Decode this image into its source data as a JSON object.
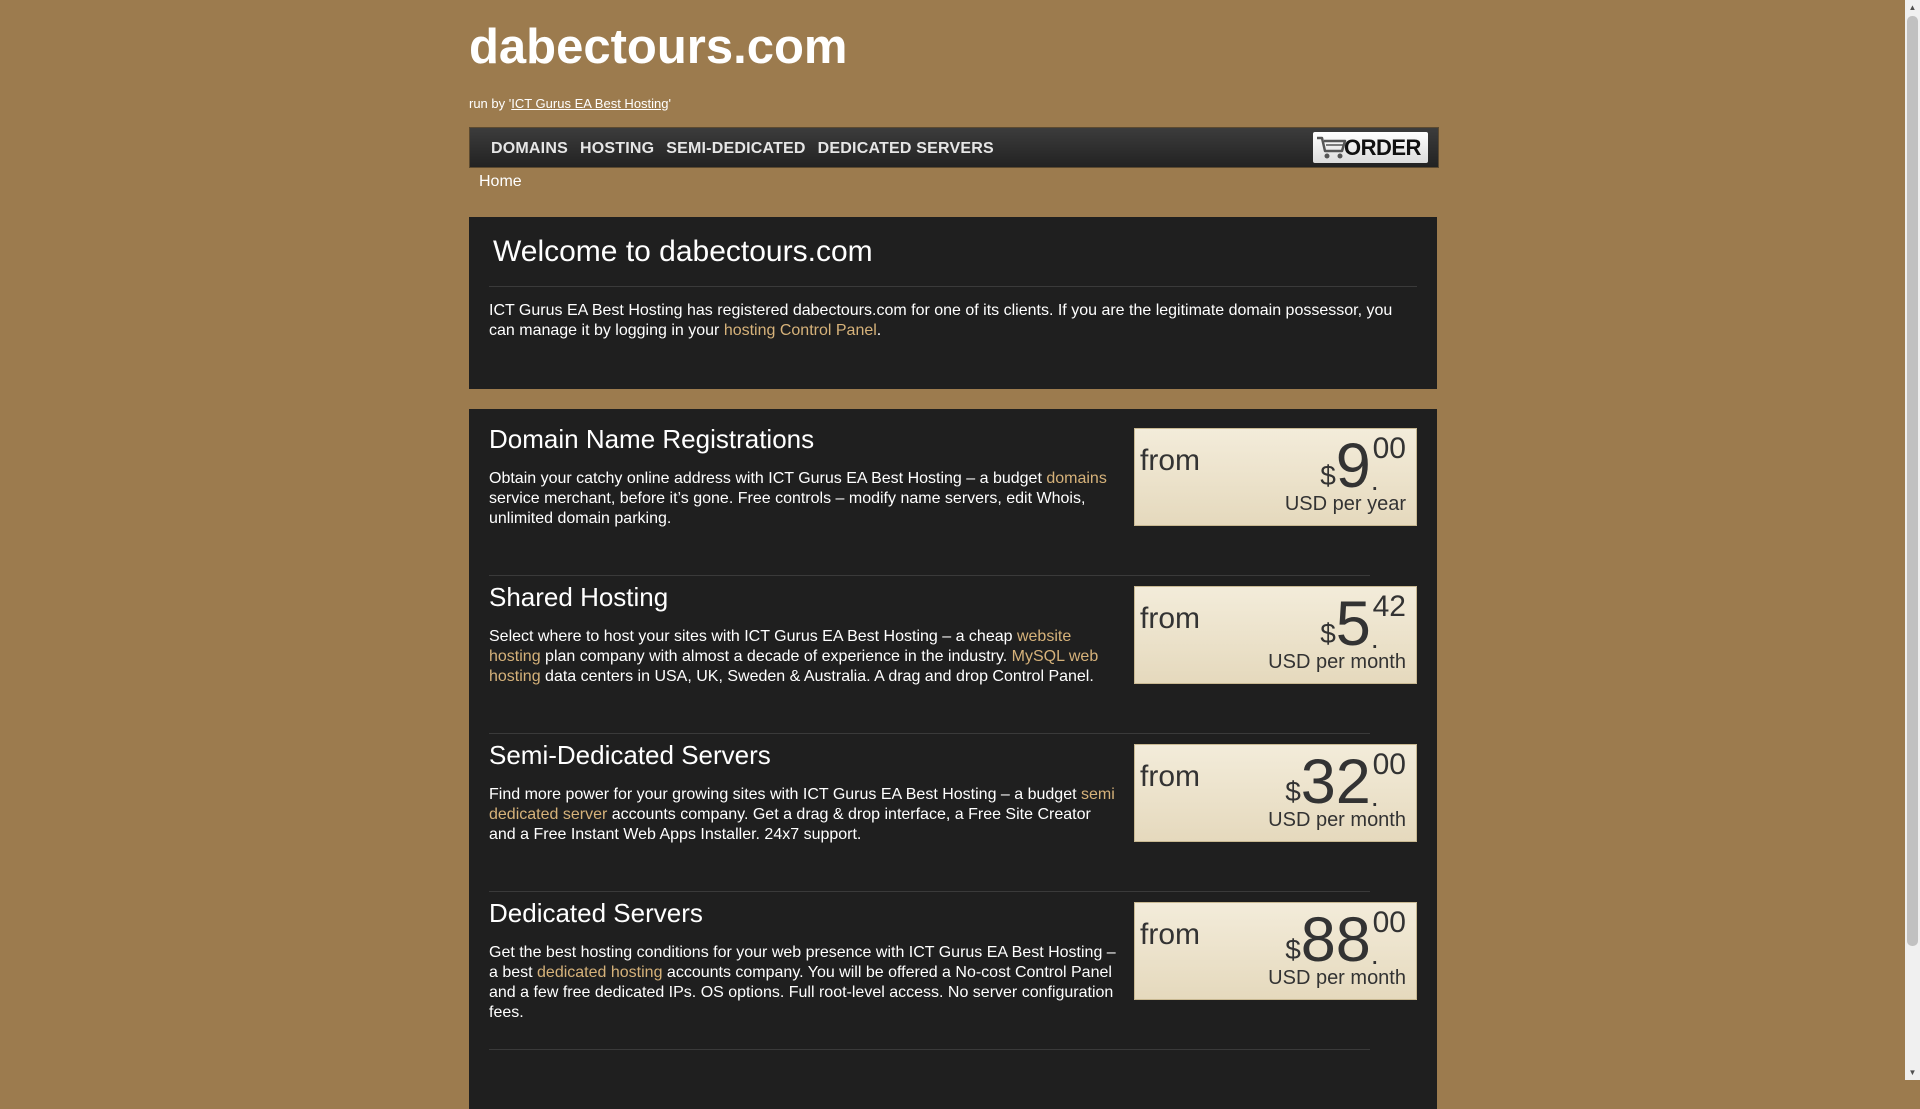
{
  "header": {
    "site_title": "dabectours.com",
    "runby_prefix": "run by '",
    "runby_link": "ICT Gurus EA Best Hosting",
    "runby_suffix": "'"
  },
  "nav": {
    "items": [
      "DOMAINS",
      "HOSTING",
      "SEMI-DEDICATED",
      "DEDICATED SERVERS"
    ],
    "order_label": "ORDER",
    "order_icon": "cart-icon"
  },
  "breadcrumb": "Home",
  "welcome": {
    "title": "Welcome to dabectours.com",
    "text_before": "ICT Gurus EA Best Hosting has registered dabectours.com for one of its clients. If you are the legitimate domain possessor, you can manage it by logging in your ",
    "link": "hosting Control Panel",
    "text_after": "."
  },
  "services": [
    {
      "title": "Domain Name Registrations",
      "parts": [
        {
          "t": "Obtain your catchy online address with ICT Gurus EA Best Hosting – a budget "
        },
        {
          "l": "domains"
        },
        {
          "t": " service merchant, before it’s gone. Free controls – modify name servers, edit Whois, unlimited domain parking."
        }
      ],
      "price": {
        "from": "from",
        "currency": "$",
        "int": "9",
        "dot": ".",
        "cents": "00",
        "period": "USD per year"
      }
    },
    {
      "title": "Shared Hosting",
      "parts": [
        {
          "t": "Select where to host your sites with ICT Gurus EA Best Hosting – a cheap "
        },
        {
          "l": "website hosting"
        },
        {
          "t": " plan company with almost a decade of experience in the industry. "
        },
        {
          "l": "MySQL web hosting"
        },
        {
          "t": " data centers in USA, UK, Sweden & Australia. A drag and drop Control Panel."
        }
      ],
      "price": {
        "from": "from",
        "currency": "$",
        "int": "5",
        "dot": ".",
        "cents": "42",
        "period": "USD per month"
      }
    },
    {
      "title": "Semi-Dedicated Servers",
      "parts": [
        {
          "t": "Find more power for your growing sites with ICT Gurus EA Best Hosting – a budget "
        },
        {
          "l": "semi dedicated server"
        },
        {
          "t": " accounts company. Get a drag & drop interface, a Free Site Creator and a Free Instant Web Apps Installer. 24x7 support."
        }
      ],
      "price": {
        "from": "from",
        "currency": "$",
        "int": "32",
        "dot": ".",
        "cents": "00",
        "period": "USD per month"
      }
    },
    {
      "title": "Dedicated Servers",
      "parts": [
        {
          "t": "Get the best hosting conditions for your web presence with ICT Gurus EA Best Hosting – a best "
        },
        {
          "l": "dedicated hosting"
        },
        {
          "t": " accounts company. You will be offered a No-cost Control Panel and a few free dedicated IPs. OS options. Full root-level access. No server configuration fees."
        }
      ],
      "price": {
        "from": "from",
        "currency": "$",
        "int": "88",
        "dot": ".",
        "cents": "00",
        "period": "USD per month"
      }
    }
  ],
  "colors": {
    "page_bg": "#9c7b4e",
    "panel_bg": "#1f1f1f",
    "link": "#d6b27a",
    "price_box_bg": "#efe6d0"
  }
}
